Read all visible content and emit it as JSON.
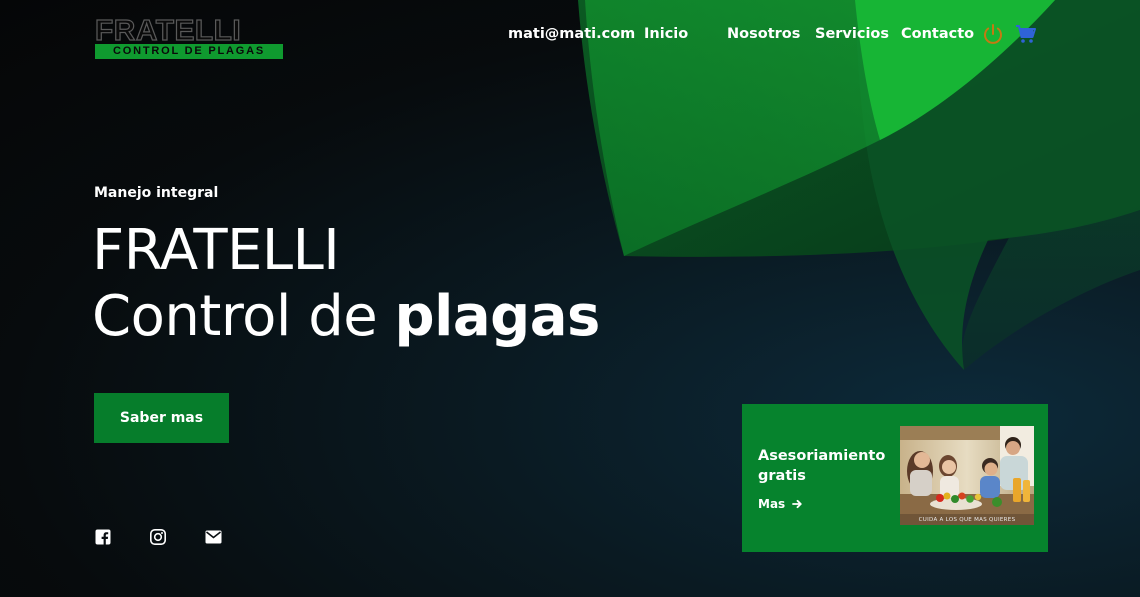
{
  "brand": {
    "name": "FRATELLI",
    "tagline": "CONTROL DE PLAGAS",
    "accent": "#067d2b",
    "accent_bright": "#14b22f"
  },
  "header": {
    "email": "mati@mati.com",
    "nav": [
      {
        "label": "Inicio"
      },
      {
        "label": "Nosotros"
      },
      {
        "label": "Servicios"
      },
      {
        "label": "Contacto"
      }
    ],
    "icons": {
      "power": {
        "icon": "power-icon",
        "color": "#c47a12"
      },
      "cart": {
        "icon": "shopping-cart-icon",
        "color": "#2f63d6"
      }
    }
  },
  "hero": {
    "kicker": "Manejo integral",
    "title_line1": "FRATELLI",
    "title_line2_prefix": "Control de ",
    "title_line2_bold": "plagas",
    "cta_label": "Saber mas"
  },
  "social": [
    {
      "icon": "facebook-icon"
    },
    {
      "icon": "instagram-icon"
    },
    {
      "icon": "mail-icon"
    }
  ],
  "promo": {
    "title": "Asesoriamiento gratis",
    "link_label": "Mas",
    "link_icon": "arrow-right-icon",
    "image_caption": "CUIDA A LOS QUE MAS QUIERES"
  }
}
